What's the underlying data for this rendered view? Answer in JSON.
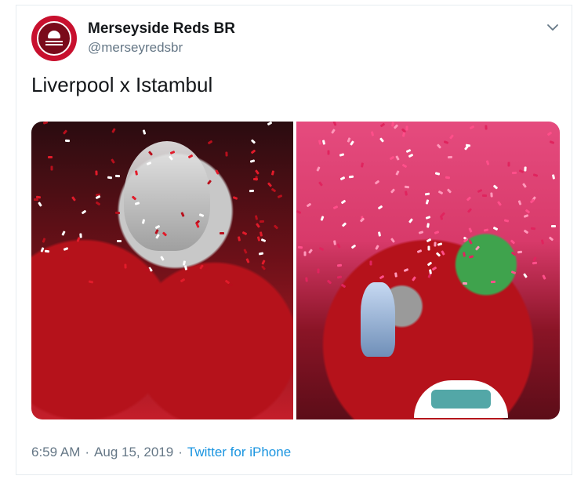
{
  "author": {
    "display_name": "Merseyside Reds BR",
    "handle": "@merseyredsbr"
  },
  "tweet": {
    "text": "Liverpool x Istambul"
  },
  "media": {
    "count": 2
  },
  "meta": {
    "time": "6:59 AM",
    "separator": "·",
    "date": "Aug 15, 2019",
    "source": "Twitter for iPhone"
  },
  "icons": {
    "menu": "chevron-down-icon",
    "avatar": "club-logo-icon"
  },
  "colors": {
    "link": "#1b95e0",
    "secondary_text": "#657786",
    "avatar_red": "#c8102e"
  }
}
